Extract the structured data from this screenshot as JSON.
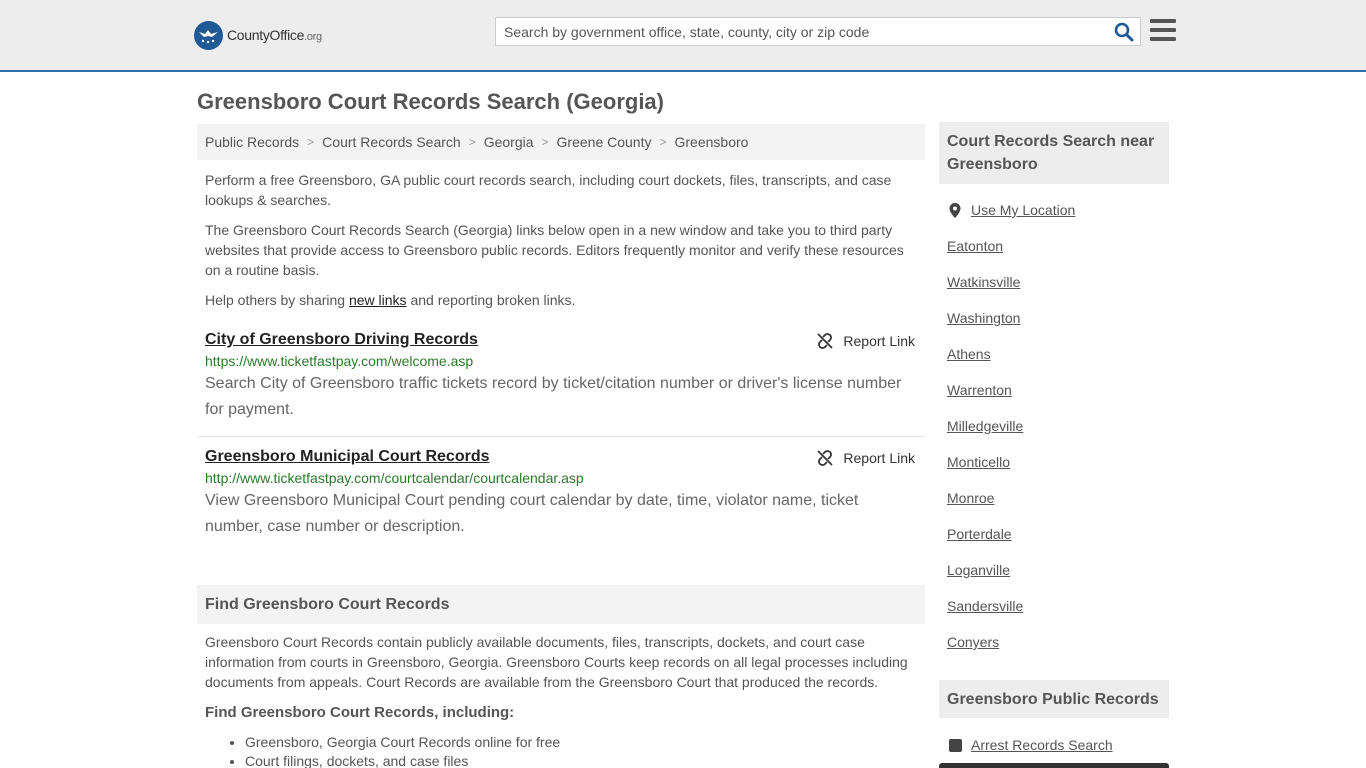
{
  "header": {
    "logo_main": "CountyOffice",
    "logo_tld": ".org",
    "search_placeholder": "Search by government office, state, county, city or zip code"
  },
  "page": {
    "title": "Greensboro Court Records Search (Georgia)"
  },
  "breadcrumb": [
    "Public Records",
    "Court Records Search",
    "Georgia",
    "Greene County",
    "Greensboro"
  ],
  "intro": {
    "p1": "Perform a free Greensboro, GA public court records search, including court dockets, files, transcripts, and case lookups & searches.",
    "p2": "The Greensboro Court Records Search (Georgia) links below open in a new window and take you to third party websites that provide access to Greensboro public records. Editors frequently monitor and verify these resources on a routine basis.",
    "p3_before": "Help others by sharing ",
    "p3_link": "new links",
    "p3_after": " and reporting broken links."
  },
  "results": [
    {
      "title": "City of Greensboro Driving Records",
      "url": "https://www.ticketfastpay.com/welcome.asp",
      "desc": "Search City of Greensboro traffic tickets record by ticket/citation number or driver's license number for payment.",
      "report": "Report Link"
    },
    {
      "title": "Greensboro Municipal Court Records",
      "url": "http://www.ticketfastpay.com/courtcalendar/courtcalendar.asp",
      "desc": "View Greensboro Municipal Court pending court calendar by date, time, violator name, ticket number, case number or description.",
      "report": "Report Link"
    }
  ],
  "find_section": {
    "heading": "Find Greensboro Court Records",
    "text": "Greensboro Court Records contain publicly available documents, files, transcripts, dockets, and court case information from courts in Greensboro, Georgia. Greensboro Courts keep records on all legal processes including documents from appeals. Court Records are available from the Greensboro Court that produced the records.",
    "subheading": "Find Greensboro Court Records, including:",
    "items": [
      "Greensboro, Georgia Court Records online for free",
      "Court filings, dockets, and case files"
    ]
  },
  "sidebar": {
    "nearby_heading": "Court Records Search near Greensboro",
    "use_location": "Use My Location",
    "nearby": [
      "Eatonton",
      "Watkinsville",
      "Washington",
      "Athens",
      "Warrenton",
      "Milledgeville",
      "Monticello",
      "Monroe",
      "Porterdale",
      "Loganville",
      "Sandersville",
      "Conyers"
    ],
    "public_heading": "Greensboro Public Records",
    "arrest_link": "Arrest Records Search"
  }
}
